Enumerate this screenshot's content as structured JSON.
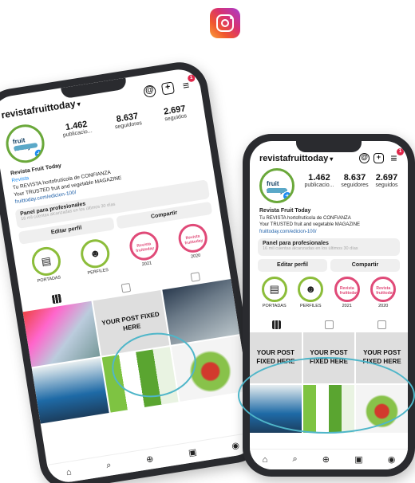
{
  "left_phone": {
    "username": "revistafruittoday",
    "stats": [
      {
        "num": "1.462",
        "label": "publicacio..."
      },
      {
        "num": "8.637",
        "label": "seguidores"
      },
      {
        "num": "2.697",
        "label": "seguidos"
      }
    ],
    "bio_name": "Revista Fruit Today",
    "bio_category": "Revista",
    "bio_line1": "Tu REVISTA hortofrutícola de CONFIANZA",
    "bio_line2": "Your TRUSTED fruit and vegetable MAGAZINE",
    "bio_link": "fruittoday.com/edicion-100/",
    "pro_title": "Panel para profesionales",
    "pro_sub": "16 mil cuentas alcanzadas en los últimos 30 días",
    "edit_btn": "Editar perfil",
    "share_btn": "Compartir",
    "highlights": [
      "PORTADAS",
      "PERFILES",
      "2021",
      "2020"
    ],
    "fixed_post": "YOUR POST FIXED HERE"
  },
  "right_phone": {
    "username": "revistafruittoday",
    "stats": [
      {
        "num": "1.462",
        "label": "publicacio..."
      },
      {
        "num": "8.637",
        "label": "seguidores"
      },
      {
        "num": "2.697",
        "label": "seguidos"
      }
    ],
    "bio_name": "Revista Fruit Today",
    "bio_line1": "Tu REVISTA hortofrutícola de CONFIANZA",
    "bio_line2": "Your TRUSTED fruit and vegetable MAGAZINE",
    "bio_link": "fruittoday.com/edicion-100/",
    "pro_title": "Panel para profesionales",
    "pro_sub": "16 mil cuentas alcanzadas en los últimos 30 días",
    "edit_btn": "Editar perfil",
    "share_btn": "Compartir",
    "highlights": [
      "PORTADAS",
      "PERFILES",
      "2021",
      "2020"
    ],
    "fixed_posts": [
      "YOUR POST FIXED HERE",
      "YOUR POST FIXED HERE",
      "YOUR POST FIXED HERE"
    ]
  },
  "badge_count": "1",
  "avatar_text": "fruit today",
  "highlight_mini_text": "Revista fruittoday",
  "accent_colors": {
    "callout": "#4fb6c9",
    "ring_green": "#8cbd3a",
    "ring_pink": "#e04a78",
    "badge": "#e0264a"
  }
}
